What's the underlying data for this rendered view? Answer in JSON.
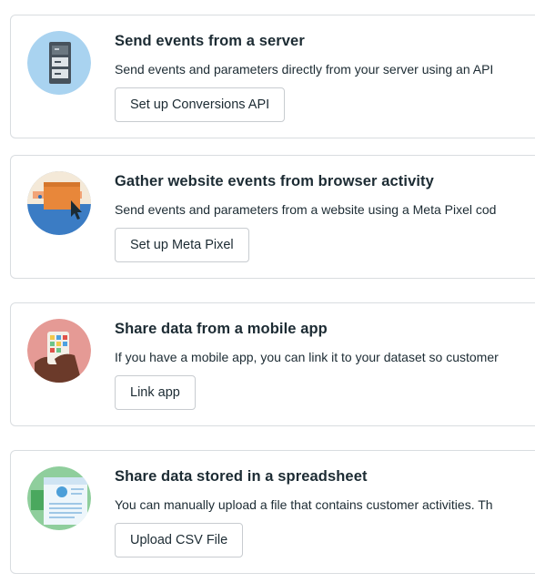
{
  "options": [
    {
      "title": "Send events from a server",
      "description": "Send events and parameters directly from your server using an API",
      "button_label": "Set up Conversions API",
      "icon": "server-icon"
    },
    {
      "title": "Gather website events from browser activity",
      "description": "Send events and parameters from a website using a Meta Pixel cod",
      "button_label": "Set up Meta Pixel",
      "icon": "browser-cursor-icon"
    },
    {
      "title": "Share data from a mobile app",
      "description": "If you have a mobile app, you can link it to your dataset so customer",
      "button_label": "Link app",
      "icon": "mobile-app-icon"
    },
    {
      "title": "Share data stored in a spreadsheet",
      "description": "You can manually upload a file that contains customer activities. Th",
      "button_label": "Upload CSV File",
      "icon": "spreadsheet-icon"
    }
  ],
  "colors": {
    "border": "#d9dde0",
    "text": "#1c2b33",
    "button_border": "#c8ccd0"
  }
}
